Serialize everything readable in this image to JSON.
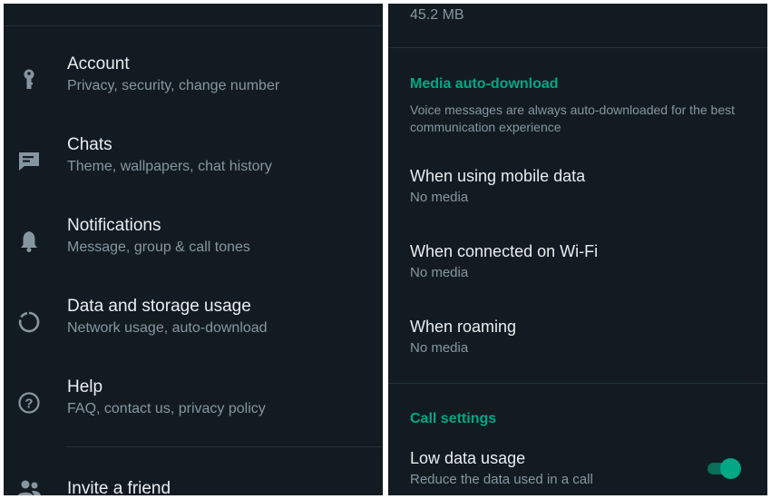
{
  "settings_list": {
    "items": [
      {
        "icon": "key-icon",
        "title": "Account",
        "subtitle": "Privacy, security, change number"
      },
      {
        "icon": "chat-icon",
        "title": "Chats",
        "subtitle": "Theme, wallpapers, chat history"
      },
      {
        "icon": "bell-icon",
        "title": "Notifications",
        "subtitle": "Message, group & call tones"
      },
      {
        "icon": "data-usage-icon",
        "title": "Data and storage usage",
        "subtitle": "Network usage, auto-download"
      },
      {
        "icon": "help-icon",
        "title": "Help",
        "subtitle": "FAQ, contact us, privacy policy"
      }
    ],
    "invite": {
      "icon": "people-icon",
      "title": "Invite a friend"
    }
  },
  "data_storage": {
    "storage_value": "45.2 MB",
    "media_section": {
      "heading": "Media auto-download",
      "note": "Voice messages are always auto-downloaded for the best communication experience",
      "options": [
        {
          "title": "When using mobile data",
          "value": "No media"
        },
        {
          "title": "When connected on Wi-Fi",
          "value": "No media"
        },
        {
          "title": "When roaming",
          "value": "No media"
        }
      ]
    },
    "call_section": {
      "heading": "Call settings",
      "low_data": {
        "title": "Low data usage",
        "subtitle": "Reduce the data used in a call",
        "enabled": true
      }
    }
  },
  "colors": {
    "accent": "#00a884",
    "background": "#121b22",
    "text_primary": "#e9edef",
    "text_secondary": "#8696a0"
  }
}
